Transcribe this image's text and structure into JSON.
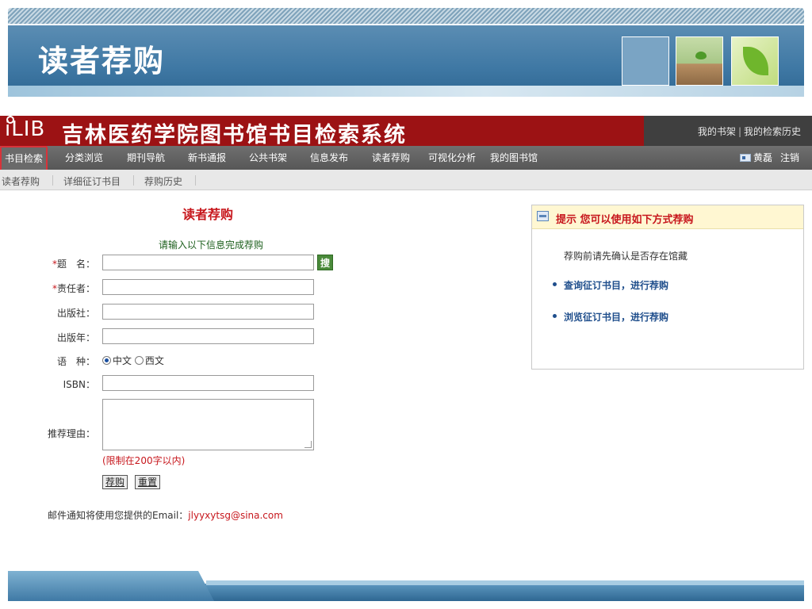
{
  "slide": {
    "title": "读者荐购"
  },
  "app": {
    "logo": "iLIB",
    "system_title": "吉林医药学院图书馆书目检索系统",
    "top_links": [
      "我的书架",
      "我的检索历史"
    ],
    "top_links_sep": "|"
  },
  "nav": {
    "items": [
      "书目检索",
      "分类浏览",
      "期刊导航",
      "新书通报",
      "公共书架",
      "信息发布",
      "读者荐购",
      "可视化分析",
      "我的图书馆"
    ],
    "active_index": 0,
    "user_name": "黄磊",
    "logout_label": "注销"
  },
  "subnav": {
    "items": [
      "读者荐购",
      "详细征订书目",
      "荐购历史"
    ]
  },
  "form": {
    "title": "读者荐购",
    "hint": "请输入以下信息完成荐购",
    "required_mark": "*",
    "labels": {
      "title": "题　名：",
      "author": "责任者：",
      "publisher": "出版社：",
      "year": "出版年：",
      "language": "语　种：",
      "isbn": "ISBN：",
      "reason": "推荐理由："
    },
    "values": {
      "title": "",
      "author": "",
      "publisher": "",
      "year": "",
      "isbn": "",
      "reason": ""
    },
    "search_button": "搜",
    "language_options": [
      "中文",
      "西文"
    ],
    "language_selected": "中文",
    "reason_limit": "(限制在200字以内)",
    "submit_label": "荐购",
    "reset_label": "重置",
    "mail_note_prefix": "邮件通知将使用您提供的Email：",
    "mail_address": "jlyyxytsg@sina.com"
  },
  "tip": {
    "title": "提示  您可以使用如下方式荐购",
    "note": "荐购前请先确认是否存在馆藏",
    "links": [
      "查询征订书目，进行荐购",
      "浏览征订书目，进行荐购"
    ]
  },
  "colors": {
    "header_red": "#9c1214",
    "accent_red": "#c7171d",
    "link_blue": "#1f4e8c",
    "banner_blue": "#3f78a4"
  }
}
